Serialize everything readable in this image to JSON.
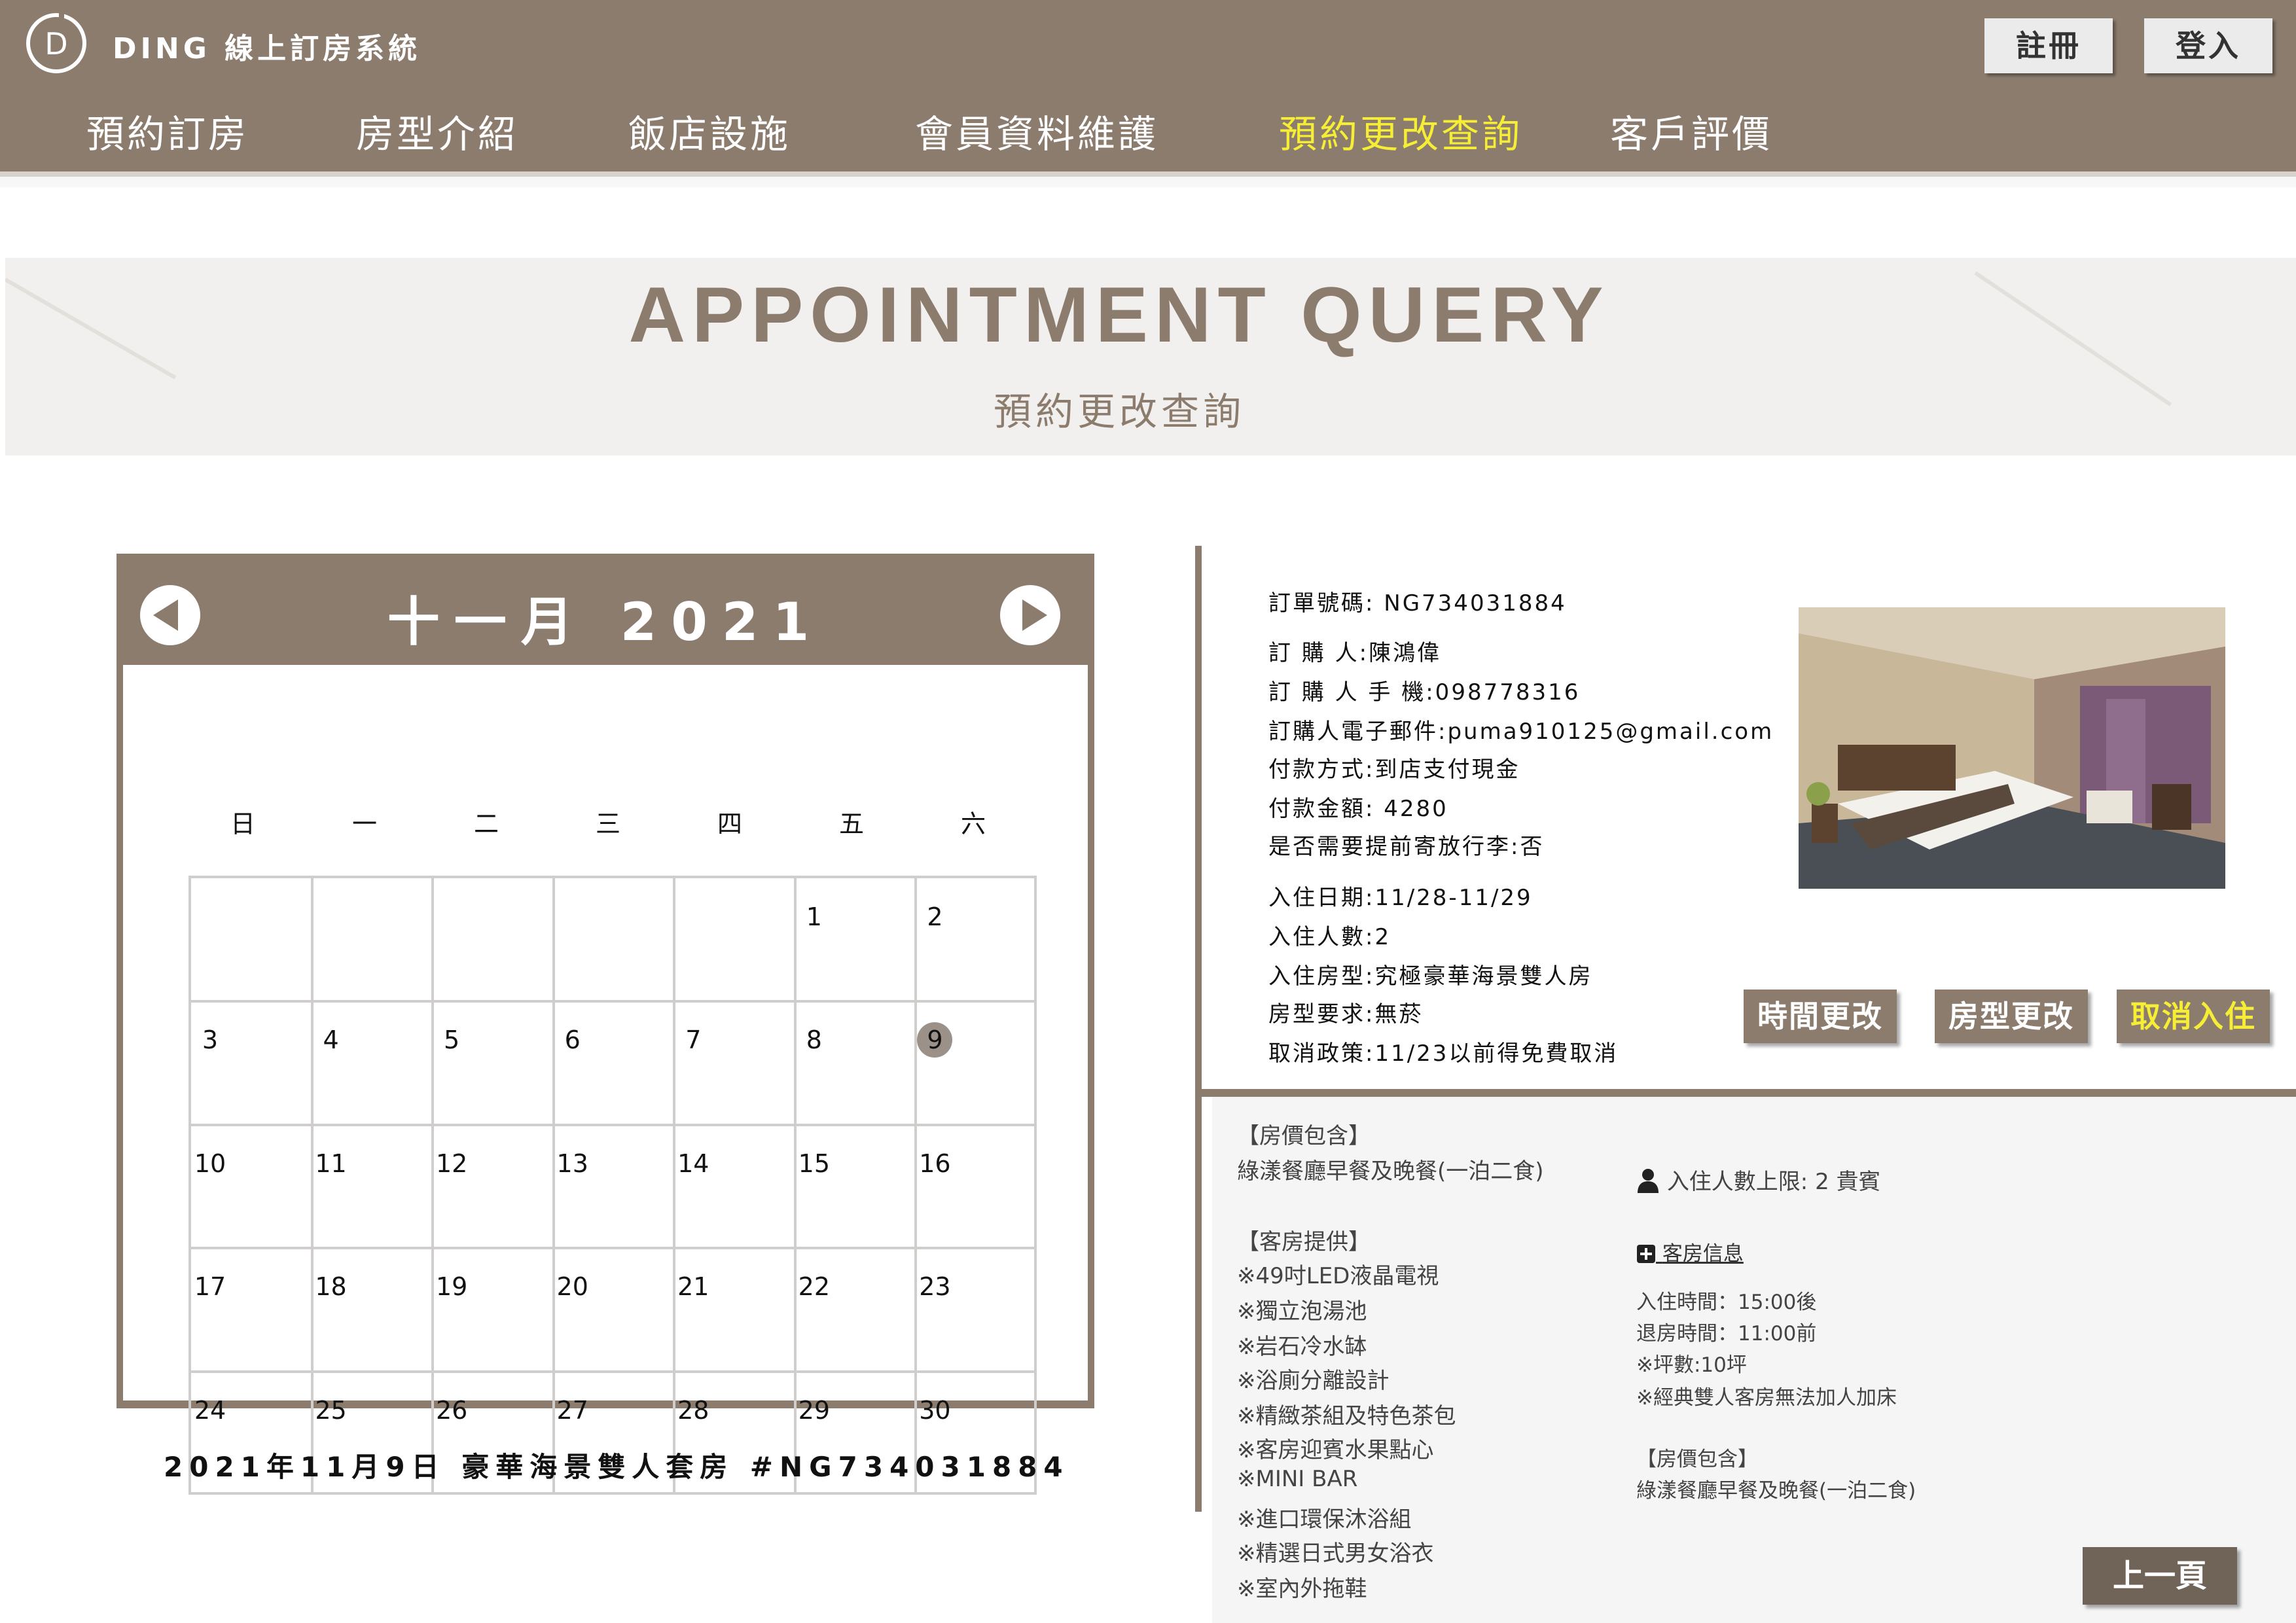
{
  "header": {
    "logo_letter": "D",
    "brand": "DING 線上訂房系統",
    "nav": [
      {
        "label": "預約訂房",
        "active": false
      },
      {
        "label": "房型介紹",
        "active": false
      },
      {
        "label": "飯店設施",
        "active": false
      },
      {
        "label": "會員資料維護",
        "active": false
      },
      {
        "label": "預約更改查詢",
        "active": true
      },
      {
        "label": "客戶評價",
        "active": false
      }
    ],
    "register_label": "註冊",
    "login_label": "登入",
    "colors": {
      "bar": "#8c7c6e",
      "active_nav": "#f6ee34"
    }
  },
  "banner": {
    "title": "APPOINTMENT QUERY",
    "subtitle": "預約更改查詢"
  },
  "calendar": {
    "month_label": "十一月 2021",
    "prev_icon": "triangle-left-icon",
    "next_icon": "triangle-right-icon",
    "weekdays": [
      "日",
      "一",
      "二",
      "三",
      "四",
      "五",
      "六"
    ],
    "weeks": [
      [
        "",
        "",
        "",
        "",
        "",
        "1",
        "2"
      ],
      [
        "3",
        "4",
        "5",
        "6",
        "7",
        "8",
        "9"
      ],
      [
        "10",
        "11",
        "12",
        "13",
        "14",
        "15",
        "16"
      ],
      [
        "17",
        "18",
        "19",
        "20",
        "21",
        "22",
        "23"
      ],
      [
        "24",
        "25",
        "26",
        "27",
        "28",
        "29",
        "30"
      ]
    ],
    "selected_day": "9",
    "caption": "2021年11月9日  豪華海景雙人套房  #NG734031884"
  },
  "order": {
    "order_no": "訂單號碼:      NG734031884",
    "buyer": "訂    購    人:陳鴻偉",
    "phone": "訂 購 人 手 機:098778316",
    "email": "訂購人電子郵件:puma910125@gmail.com",
    "payment_method": "付款方式:到店支付現金",
    "amount": "付款金額: 4280",
    "luggage": "是否需要提前寄放行李:否",
    "checkin_date": "入住日期:11/28-11/29",
    "guests": "入住人數:2",
    "room_type": "入住房型:究極豪華海景雙人房",
    "room_request": "房型要求:無菸",
    "cancel_policy": "取消政策:11/23以前得免費取消",
    "btn_change_time": "時間更改",
    "btn_change_room": "房型更改",
    "btn_cancel": "取消入住"
  },
  "room": {
    "price_include_title": "【房價包含】",
    "price_include_text": "綠漾餐廳早餐及晚餐(一泊二食)",
    "amenities_title": "【客房提供】",
    "amenities": [
      "※49吋LED液晶電視",
      "※獨立泡湯池",
      "※岩石冷水缽",
      "※浴廁分離設計",
      "※精緻茶組及特色茶包",
      "※客房迎賓水果點心",
      "※MINI BAR",
      "※進口環保沐浴組",
      "※精選日式男女浴衣",
      "※室內外拖鞋"
    ],
    "max_guests": "入住人數上限: 2 貴賓",
    "room_info_link": "客房信息",
    "checkin_time": "入住時間：15:00後",
    "checkout_time": "退房時間：11:00前",
    "size": "※坪數:10坪",
    "no_extra_bed": "※經典雙人客房無法加人加床",
    "price_include_title2": "【房價包含】",
    "price_include_text2": "綠漾餐廳早餐及晚餐(一泊二食)",
    "back_label": "上一頁"
  }
}
